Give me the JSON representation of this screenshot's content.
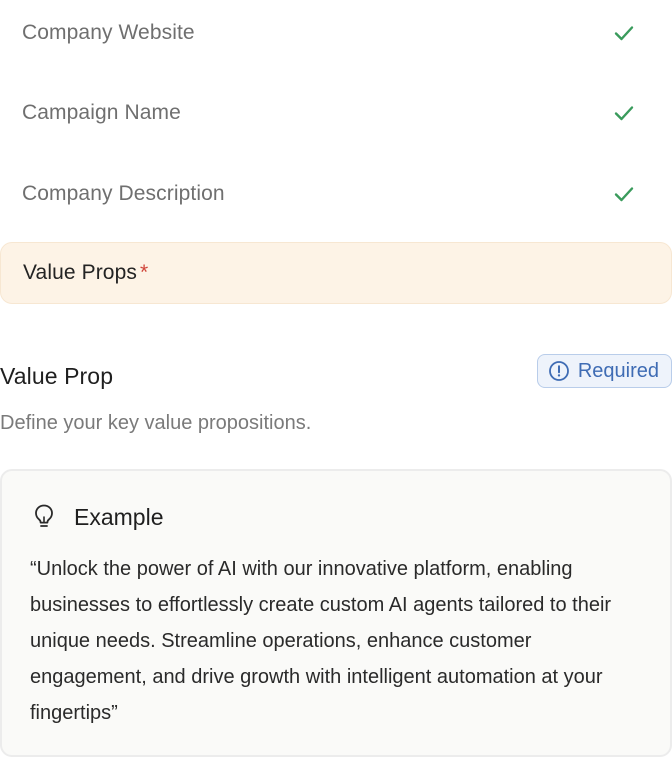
{
  "steps": [
    {
      "label": "Company Website",
      "status": "complete"
    },
    {
      "label": "Campaign Name",
      "status": "complete"
    },
    {
      "label": "Company Description",
      "status": "complete"
    },
    {
      "label": "Value Props",
      "status": "active",
      "required_mark": "*"
    }
  ],
  "section": {
    "title": "Value Prop",
    "badge": "Required",
    "description": "Define your key value propositions."
  },
  "example": {
    "title": "Example",
    "text": "“Unlock the power of AI with our innovative platform, enabling businesses to effortlessly create custom AI agents tailored to their unique needs. Streamline operations, enhance customer engagement, and drive growth with intelligent automation at your fingertips”"
  },
  "colors": {
    "check": "#3a9b5c",
    "active_bg": "#fdf3e6",
    "required_mark": "#d0453a",
    "badge_text": "#3f6cb4",
    "badge_bg": "#eef3fb"
  },
  "icons": {
    "check": "check-icon",
    "badge": "alert-circle-icon",
    "example": "lightbulb-icon"
  }
}
